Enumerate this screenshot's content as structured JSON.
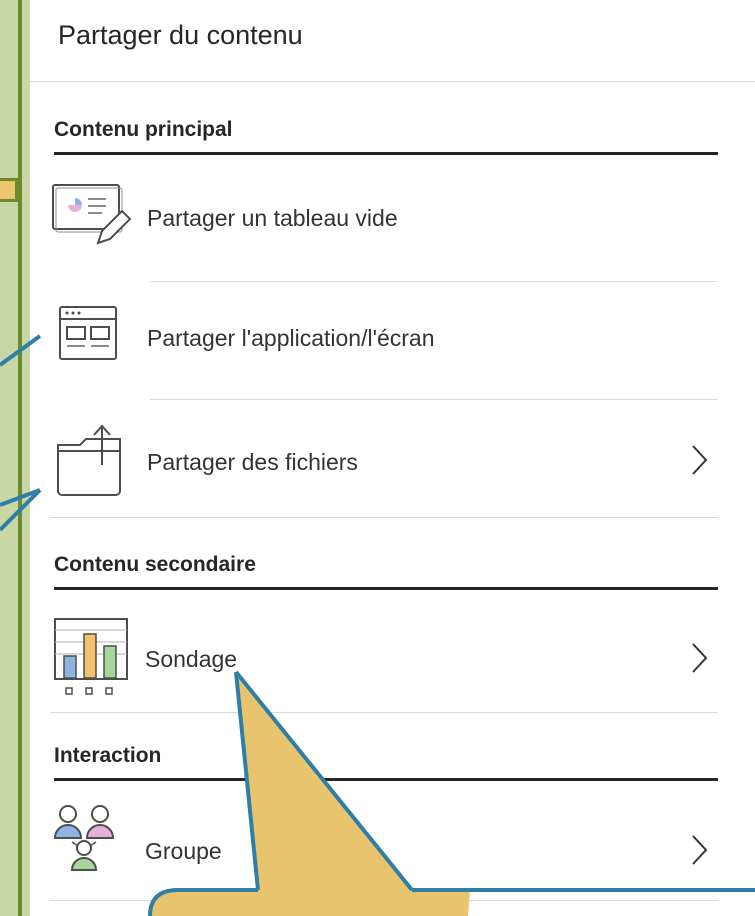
{
  "panel": {
    "title": "Partager du contenu",
    "sections": [
      {
        "title": "Contenu principal"
      },
      {
        "title": "Contenu secondaire"
      },
      {
        "title": "Interaction"
      }
    ],
    "items": [
      {
        "label": "Partager un tableau vide",
        "icon": "whiteboard-icon",
        "has_chevron": false
      },
      {
        "label": "Partager l'application/l'écran",
        "icon": "application-window-icon",
        "has_chevron": false
      },
      {
        "label": "Partager des fichiers",
        "icon": "folder-upload-icon",
        "has_chevron": true
      },
      {
        "label": "Sondage",
        "icon": "poll-chart-icon",
        "has_chevron": true
      },
      {
        "label": "Groupe",
        "icon": "groups-icon",
        "has_chevron": true
      }
    ]
  },
  "colors": {
    "background": "#c9d7a6",
    "frame": "#6b8a2d",
    "callout_fill": "#e9c46e",
    "callout_stroke": "#2e7ea6",
    "icon_blue": "#8fb4e3",
    "icon_orange": "#f2c26b",
    "icon_green": "#a6d79a",
    "icon_pink": "#e7b0d6"
  }
}
